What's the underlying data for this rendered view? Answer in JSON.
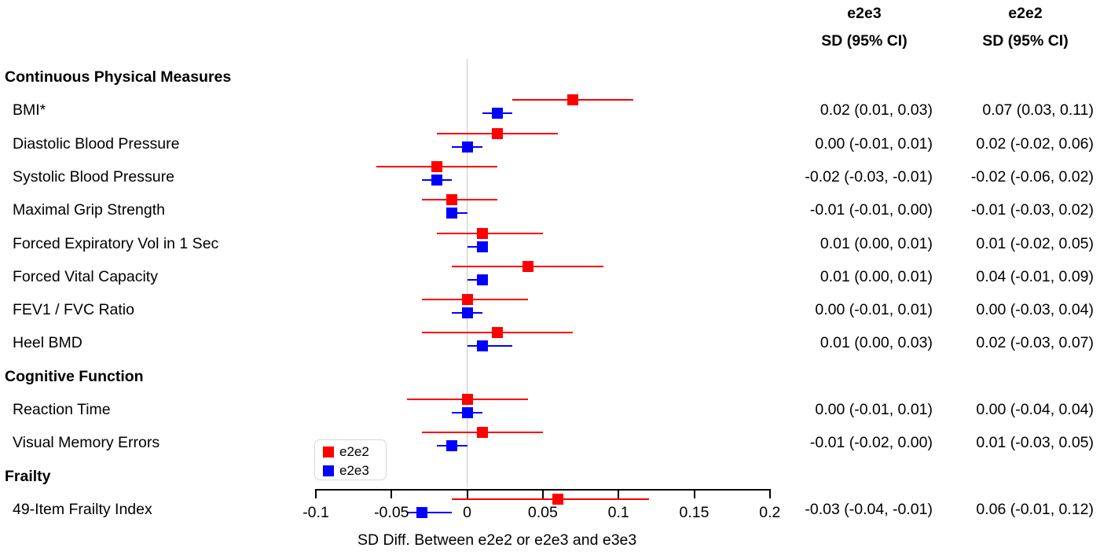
{
  "figure": {
    "axis_title": "SD Diff. Between e2e2 or e2e3 and e3e3",
    "col_header_1_line1": "e2e3",
    "col_header_1_line2": "SD (95% CI)",
    "col_header_2_line1": "e2e2",
    "col_header_2_line2": "SD (95% CI)"
  },
  "legend": {
    "items": [
      {
        "label": "e2e2",
        "color": "#ff0000"
      },
      {
        "label": "e2e3",
        "color": "#0000ff"
      }
    ]
  },
  "colors": {
    "e2e2": "#ff0000",
    "e2e3": "#0000ff",
    "zero_line": "#c9c9c9",
    "axis": "#000000",
    "text": "#000000"
  },
  "rows": [
    {
      "type": "group",
      "label": "Continuous Physical Measures"
    },
    {
      "type": "item",
      "label": "BMI*",
      "e2e3_text": "0.02 (0.01, 0.03)",
      "e2e2_text": "0.07 (0.03, 0.11)"
    },
    {
      "type": "item",
      "label": "Diastolic Blood Pressure",
      "e2e3_text": "0.00 (-0.01, 0.01)",
      "e2e2_text": "0.02 (-0.02, 0.06)"
    },
    {
      "type": "item",
      "label": "Systolic Blood Pressure",
      "e2e3_text": "-0.02 (-0.03, -0.01)",
      "e2e2_text": "-0.02 (-0.06, 0.02)"
    },
    {
      "type": "item",
      "label": "Maximal Grip Strength",
      "e2e3_text": "-0.01 (-0.01, 0.00)",
      "e2e2_text": "-0.01 (-0.03, 0.02)"
    },
    {
      "type": "item",
      "label": "Forced Expiratory Vol in 1 Sec",
      "e2e3_text": "0.01 (0.00, 0.01)",
      "e2e2_text": "0.01 (-0.02, 0.05)"
    },
    {
      "type": "item",
      "label": "Forced Vital Capacity",
      "e2e3_text": "0.01 (0.00, 0.01)",
      "e2e2_text": "0.04 (-0.01, 0.09)"
    },
    {
      "type": "item",
      "label": "FEV1 / FVC Ratio",
      "e2e3_text": "0.00 (-0.01, 0.01)",
      "e2e2_text": "0.00 (-0.03, 0.04)"
    },
    {
      "type": "item",
      "label": "Heel BMD",
      "e2e3_text": "0.01 (0.00, 0.03)",
      "e2e2_text": "0.02 (-0.03, 0.07)"
    },
    {
      "type": "group",
      "label": "Cognitive Function"
    },
    {
      "type": "item",
      "label": "Reaction Time",
      "e2e3_text": "0.00 (-0.01, 0.01)",
      "e2e2_text": "0.00 (-0.04, 0.04)"
    },
    {
      "type": "item",
      "label": "Visual Memory Errors",
      "e2e3_text": "-0.01 (-0.02, 0.00)",
      "e2e2_text": "0.01 (-0.03, 0.05)"
    },
    {
      "type": "group",
      "label": "Frailty"
    },
    {
      "type": "item",
      "label": "49-Item Frailty Index",
      "e2e3_text": "-0.03 (-0.04, -0.01)",
      "e2e2_text": "0.06 (-0.01, 0.12)"
    }
  ],
  "chart_data": {
    "type": "scatter",
    "subtype": "forest-plot",
    "title": "",
    "xlabel": "SD Diff. Between e2e2 or e2e3 and e3e3",
    "ylabel": "",
    "xlim": [
      -0.1,
      0.2
    ],
    "xticks": [
      -0.1,
      -0.05,
      0,
      0.05,
      0.1,
      0.15,
      0.2
    ],
    "xticklabels": [
      "-0.1",
      "-0.05",
      "0",
      "0.05",
      "0.1",
      "0.15",
      "0.2"
    ],
    "grid": false,
    "reference_line_x": 0,
    "legend_position": "bottom-left",
    "categories": [
      "BMI*",
      "Diastolic Blood Pressure",
      "Systolic Blood Pressure",
      "Maximal Grip Strength",
      "Forced Expiratory Vol in 1 Sec",
      "Forced Vital Capacity",
      "FEV1 / FVC Ratio",
      "Heel BMD",
      "Reaction Time",
      "Visual Memory Errors",
      "49-Item Frailty Index"
    ],
    "series": [
      {
        "name": "e2e2",
        "color": "#ff0000",
        "estimates": [
          0.07,
          0.02,
          -0.02,
          -0.01,
          0.01,
          0.04,
          0.0,
          0.02,
          0.0,
          0.01,
          0.06
        ],
        "ci_low": [
          0.03,
          -0.02,
          -0.06,
          -0.03,
          -0.02,
          -0.01,
          -0.03,
          -0.03,
          -0.04,
          -0.03,
          -0.01
        ],
        "ci_high": [
          0.11,
          0.06,
          0.02,
          0.02,
          0.05,
          0.09,
          0.04,
          0.07,
          0.04,
          0.05,
          0.12
        ]
      },
      {
        "name": "e2e3",
        "color": "#0000ff",
        "estimates": [
          0.02,
          0.0,
          -0.02,
          -0.01,
          0.01,
          0.01,
          0.0,
          0.01,
          0.0,
          -0.01,
          -0.03
        ],
        "ci_low": [
          0.01,
          -0.01,
          -0.03,
          -0.01,
          0.0,
          0.0,
          -0.01,
          0.0,
          -0.01,
          -0.02,
          -0.04
        ],
        "ci_high": [
          0.03,
          0.01,
          -0.01,
          0.0,
          0.01,
          0.01,
          0.01,
          0.03,
          0.01,
          0.0,
          -0.01
        ]
      }
    ]
  }
}
